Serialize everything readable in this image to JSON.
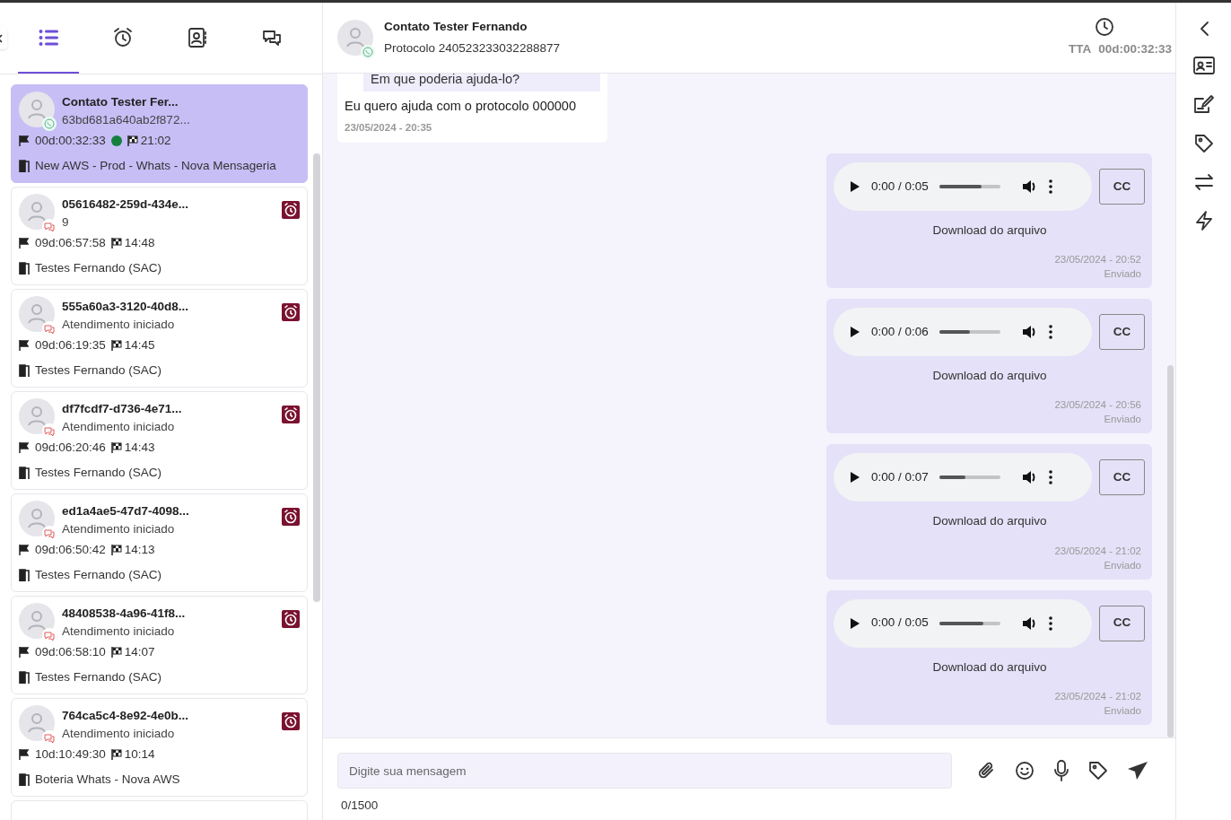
{
  "nav_tabs": [
    {
      "selected": true
    },
    {
      "selected": false
    },
    {
      "selected": false
    },
    {
      "selected": false
    }
  ],
  "conversations": [
    {
      "title": "Contato Tester Fer...",
      "subtitle": "63bd681a640ab2f872...",
      "kind": "whatsapp",
      "duration": "00d:00:32:33",
      "online": true,
      "time": "21:02",
      "queue": "New AWS - Prod - Whats - Nova Mensageria",
      "alarm": false,
      "selected": true
    },
    {
      "title": "05616482-259d-434e...",
      "subtitle": "9",
      "kind": "chat",
      "duration": "09d:06:57:58",
      "online": false,
      "time": "14:48",
      "queue": "Testes Fernando (SAC)",
      "alarm": true,
      "selected": false
    },
    {
      "title": "555a60a3-3120-40d8...",
      "subtitle": "Atendimento iniciado",
      "kind": "chat",
      "duration": "09d:06:19:35",
      "online": false,
      "time": "14:45",
      "queue": "Testes Fernando (SAC)",
      "alarm": true,
      "selected": false
    },
    {
      "title": "df7fcdf7-d736-4e71...",
      "subtitle": "Atendimento iniciado",
      "kind": "chat",
      "duration": "09d:06:20:46",
      "online": false,
      "time": "14:43",
      "queue": "Testes Fernando (SAC)",
      "alarm": true,
      "selected": false
    },
    {
      "title": "ed1a4ae5-47d7-4098...",
      "subtitle": "Atendimento iniciado",
      "kind": "chat",
      "duration": "09d:06:50:42",
      "online": false,
      "time": "14:13",
      "queue": "Testes Fernando (SAC)",
      "alarm": true,
      "selected": false
    },
    {
      "title": "48408538-4a96-41f8...",
      "subtitle": "Atendimento iniciado",
      "kind": "chat",
      "duration": "09d:06:58:10",
      "online": false,
      "time": "14:07",
      "queue": "Testes Fernando (SAC)",
      "alarm": true,
      "selected": false
    },
    {
      "title": "764ca5c4-8e92-4e0b...",
      "subtitle": "Atendimento iniciado",
      "kind": "chat",
      "duration": "10d:10:49:30",
      "online": false,
      "time": "10:14",
      "queue": "Boteria Whats - Nova AWS",
      "alarm": true,
      "selected": false
    }
  ],
  "chat_header": {
    "name": "Contato Tester Fernando",
    "protocol": "Protocolo 240523233032288877",
    "tta_label": "TTA",
    "tta_value": "00d:00:32:33"
  },
  "messages": [
    {
      "kind": "text",
      "quote": "Em que poderia ajuda-lo?",
      "text": "Eu quero ajuda com o protocolo 000000",
      "date": "23/05/2024 - 20:35"
    },
    {
      "kind": "audio",
      "time": "0:00 / 0:05",
      "level": 0.7,
      "cc": "CC",
      "download": "Download do arquivo",
      "date": "23/05/2024 - 20:52",
      "status": "Enviado"
    },
    {
      "kind": "audio",
      "time": "0:00 / 0:06",
      "level": 0.5,
      "cc": "CC",
      "download": "Download do arquivo",
      "date": "23/05/2024 - 20:56",
      "status": "Enviado"
    },
    {
      "kind": "audio",
      "time": "0:00 / 0:07",
      "level": 0.43,
      "cc": "CC",
      "download": "Download do arquivo",
      "date": "23/05/2024 - 21:02",
      "status": "Enviado"
    },
    {
      "kind": "audio",
      "time": "0:00 / 0:05",
      "level": 0.72,
      "cc": "CC",
      "download": "Download do arquivo",
      "date": "23/05/2024 - 21:02",
      "status": "Enviado"
    }
  ],
  "composer": {
    "placeholder": "Digite sua mensagem",
    "counter": "0/1500"
  }
}
